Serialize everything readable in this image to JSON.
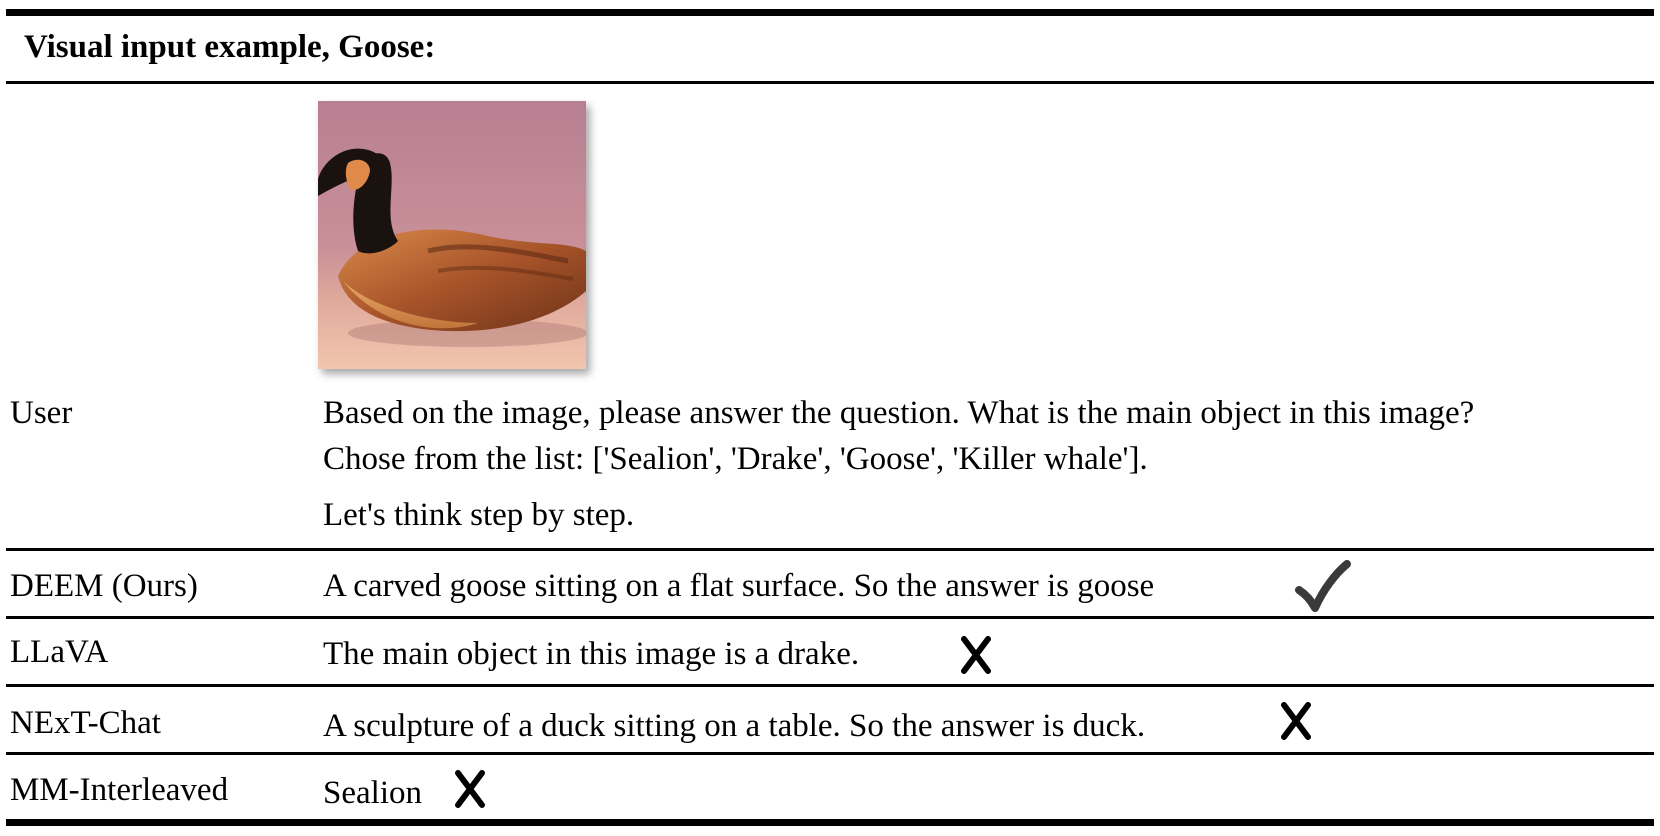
{
  "table": {
    "title": "Visual input example, Goose:",
    "user": {
      "role": "User",
      "prompt_line1": "Based on the image, please answer the question. What is the main object in this image?",
      "prompt_line2": "Chose from the list: ['Sealion', 'Drake', 'Goose', 'Killer whale'].",
      "prompt_line3": "Let's think step by step."
    },
    "rows": [
      {
        "model": "DEEM (Ours)",
        "answer": "A carved goose sitting on a flat surface. So the answer is goose",
        "verdict_icon": "check-icon"
      },
      {
        "model": "LLaVA",
        "answer": "The main object in this image is a drake.",
        "verdict_icon": "cross-icon"
      },
      {
        "model": "NExT-Chat",
        "answer": "A sculpture of a duck sitting on a table. So the answer is duck.",
        "verdict_icon": "cross-icon"
      },
      {
        "model": "MM-Interleaved",
        "answer": "Sealion",
        "verdict_icon": "cross-icon"
      }
    ]
  },
  "colors": {
    "check": "#3a3a3a",
    "cross": "#000000",
    "photo_background": "#c48a96"
  }
}
